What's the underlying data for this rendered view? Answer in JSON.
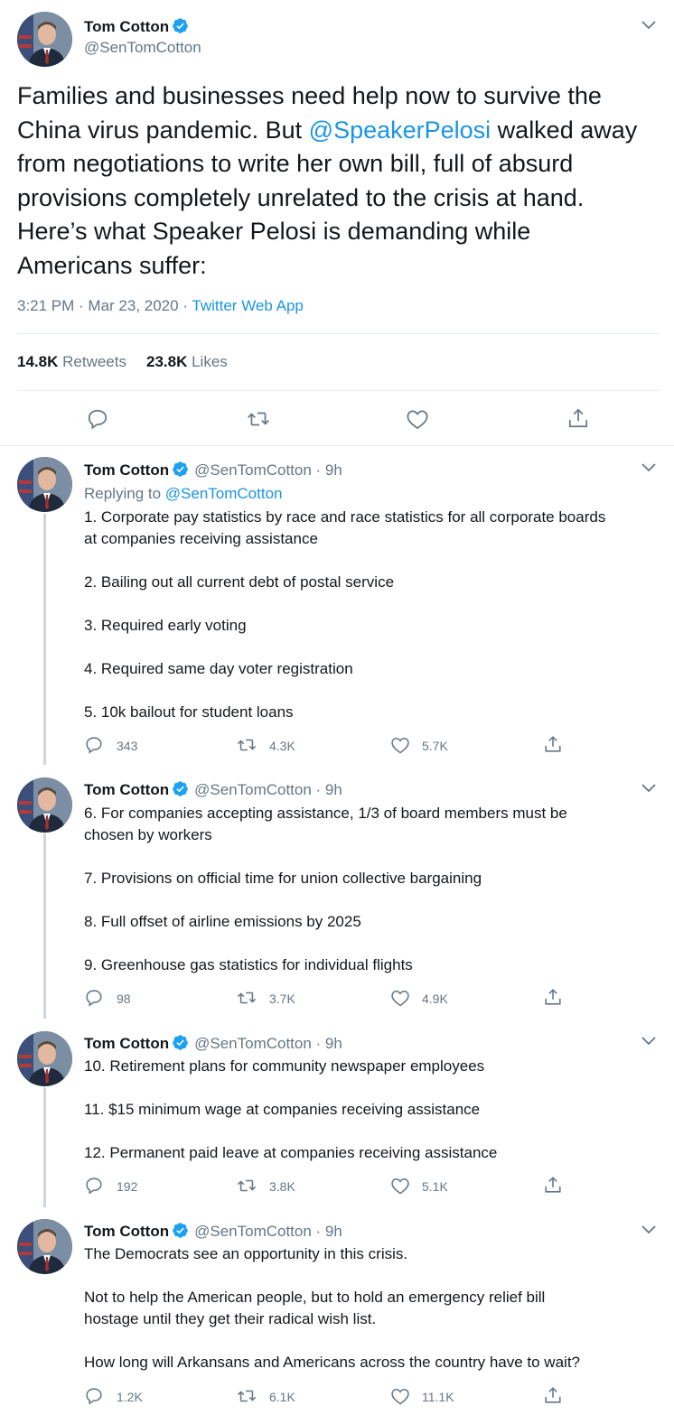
{
  "main_tweet": {
    "author_name": "Tom Cotton",
    "author_handle": "@SenTomCotton",
    "text_lines": [
      [
        "Families and businesses need help now to survive the"
      ],
      [
        "China virus pandemic. But ",
        "@SpeakerPelosi",
        " walked away"
      ],
      [
        "from negotiations to write her own bill, full of absurd"
      ],
      [
        "provisions completely unrelated to the crisis at hand."
      ],
      [
        "Here’s what Speaker Pelosi is demanding while"
      ],
      [
        "Americans suffer:"
      ]
    ],
    "time": "3:21 PM · Mar 23, 2020 · ",
    "app": "Twitter Web App",
    "retweets_count": "14.8K",
    "retweets_label": "Retweets",
    "likes_count": "23.8K",
    "likes_label": "Likes"
  },
  "replies": [
    {
      "name": "Tom Cotton",
      "handle": "@SenTomCotton · 9h",
      "replying_to_label": "Replying to ",
      "replying_to_handle": "@SenTomCotton",
      "lines": [
        "1. Corporate pay statistics by race and race statistics for all corporate boards",
        "at companies receiving assistance",
        "2. Bailing out all current debt of postal service",
        "3. Required early voting",
        "4. Required same day voter registration",
        "5. 10k bailout for student loans"
      ],
      "replies": "343",
      "retweets": "4.3K",
      "likes": "5.7K"
    },
    {
      "name": "Tom Cotton",
      "handle": "@SenTomCotton · 9h",
      "lines": [
        "6. For companies accepting assistance, 1/3 of board members must be",
        "chosen by workers",
        "7. Provisions on official time for union collective bargaining",
        "8. Full offset of airline emissions by 2025",
        "9. Greenhouse gas statistics for individual flights"
      ],
      "replies": "98",
      "retweets": "3.7K",
      "likes": "4.9K"
    },
    {
      "name": "Tom Cotton",
      "handle": "@SenTomCotton · 9h",
      "lines": [
        "10. Retirement plans for community newspaper employees",
        "11. $15 minimum wage at companies receiving assistance",
        "12. Permanent paid leave at companies receiving assistance"
      ],
      "replies": "192",
      "retweets": "3.8K",
      "likes": "5.1K"
    },
    {
      "name": "Tom Cotton",
      "handle": "@SenTomCotton · 9h",
      "lines": [
        "The Democrats see an opportunity in this crisis.",
        "Not to help the American people, but to hold an emergency relief bill",
        "hostage until they get their radical wish list.",
        "How long will Arkansans and Americans across the country have to wait?"
      ],
      "replies": "1.2K",
      "retweets": "6.1K",
      "likes": "11.1K"
    }
  ],
  "icons": {
    "verified": "verified-badge-icon",
    "caret": "chevron-down-icon",
    "reply": "reply-icon",
    "retweet": "retweet-icon",
    "like": "heart-icon",
    "share": "share-icon"
  },
  "colors": {
    "link": "#1b95e0",
    "secondary_text": "#657786",
    "primary_text": "#14171a",
    "divider": "#e6ecf0"
  }
}
